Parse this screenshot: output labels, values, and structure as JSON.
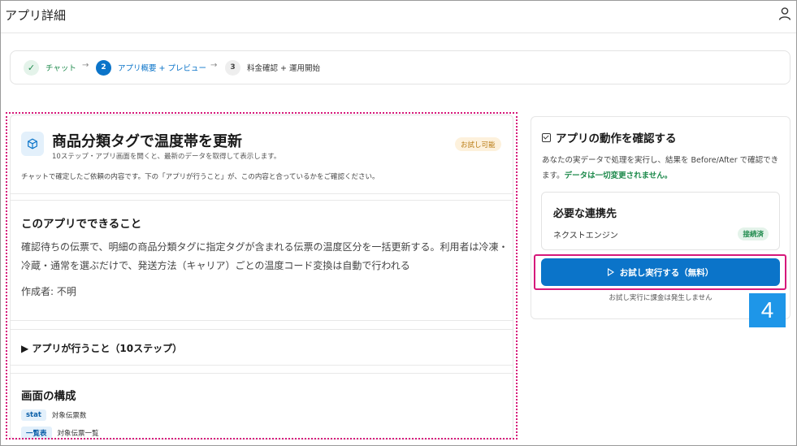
{
  "header": {
    "title": "アプリ詳細",
    "user_icon": "user-icon"
  },
  "stepper": {
    "steps": [
      {
        "number": "✓",
        "label": "チャット",
        "state": "done"
      },
      {
        "number": "2",
        "label": "アプリ概要 + プレビュー",
        "state": "active"
      },
      {
        "number": "3",
        "label": "料金確認 + 運用開始",
        "state": "pending"
      }
    ],
    "separator": "→"
  },
  "app": {
    "icon": "cube-icon",
    "title": "商品分類タグで温度帯を更新",
    "subtitle": "10ステップ・アプリ画面を開くと、最新のデータを取得して表示します。",
    "badge": "お試し可能",
    "confirm_note": "チャットで確定したご依頼の内容です。下の「アプリが行うこと」が、この内容と合っているかをご確認ください。"
  },
  "capabilities": {
    "title": "このアプリでできること",
    "description": "確認待ちの伝票で、明細の商品分類タグに指定タグが含まれる伝票の温度区分を一括更新する。利用者は冷凍・冷蔵・通常を選ぶだけで、発送方法（キャリア）ごとの温度コード変換は自動で行われる",
    "author": "作成者: 不明"
  },
  "steps_section": {
    "label": "▶ アプリが行うこと（10ステップ）"
  },
  "composition": {
    "title": "画面の構成",
    "items": [
      {
        "tag": "stat",
        "label": "対象伝票数"
      },
      {
        "tag": "一覧表",
        "label": "対象伝票一覧"
      }
    ]
  },
  "side": {
    "title": "アプリの動作を確認する",
    "text_before": "あなたの実データで処理を実行し、結果を Before/After で確認できます。",
    "text_green": "データは一切変更されません。",
    "connections_title": "必要な連携先",
    "connection_name": "ネクストエンジン",
    "connection_status": "接続済",
    "run_button": "お試し実行する（無料）",
    "no_charge": "お試し実行に課金は発生しません"
  },
  "annotation": {
    "step_number": "4"
  },
  "colors": {
    "accent": "#0b74c9",
    "highlight": "#d6187a",
    "success": "#1e8a4c",
    "badge_warn": "#b8790f"
  }
}
